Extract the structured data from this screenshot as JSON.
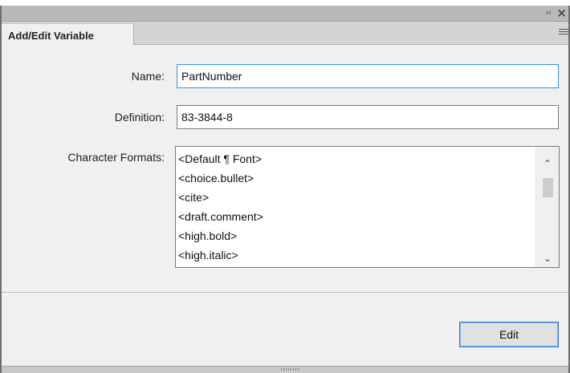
{
  "window": {
    "tab_title": "Add/Edit Variable",
    "collapse_glyph": "‹‹",
    "close_glyph": "×"
  },
  "form": {
    "name_label": "Name:",
    "name_value": "PartNumber",
    "definition_label": "Definition:",
    "definition_value": "83-3844-8",
    "formats_label": "Character Formats:",
    "formats": [
      "<Default ¶ Font>",
      "<choice.bullet>",
      "<cite>",
      "<draft.comment>",
      "<high.bold>",
      "<high.italic>"
    ]
  },
  "scroll": {
    "up_glyph": "⌃",
    "down_glyph": "⌄"
  },
  "actions": {
    "edit_label": "Edit"
  },
  "colors": {
    "accent": "#3c8fd9",
    "panel_bg": "#f0f0f0",
    "titlebar_bg": "#b9b9b9"
  }
}
